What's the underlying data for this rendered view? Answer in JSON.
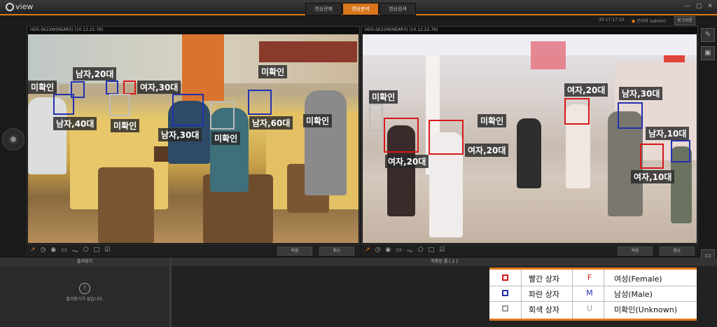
{
  "app": {
    "logo": "view"
  },
  "tabs": [
    {
      "label": "영상관제"
    },
    {
      "label": "영상분석"
    },
    {
      "label": "영상검색"
    }
  ],
  "window_controls": [
    "—",
    "□",
    "✕"
  ],
  "status": {
    "time": "30  17:17:10",
    "user": "관리자 (admin)",
    "logout": "로그아웃"
  },
  "panels": [
    {
      "title": "HDS-SK22W(NEAR3) (10.12.22.76)",
      "btn1": "적용",
      "btn2": "취소"
    },
    {
      "title": "HDS-SK22W(NEAR3) (10.12.22.76)",
      "btn1": "적용",
      "btn2": "취소"
    }
  ],
  "control_icons": [
    "↗",
    "◷",
    "◉",
    "▭",
    "〜",
    "⬠",
    "□",
    "☑"
  ],
  "detections_left": [
    {
      "label": "남자,20대"
    },
    {
      "label": "미확인"
    },
    {
      "label": "여자,30대"
    },
    {
      "label": "미확인"
    },
    {
      "label": "남자,40대"
    },
    {
      "label": "미확인"
    },
    {
      "label": "남자,30대"
    },
    {
      "label": "미확인"
    },
    {
      "label": "남자,60대"
    },
    {
      "label": "미확인"
    }
  ],
  "detections_right": [
    {
      "label": "미확인"
    },
    {
      "label": "여자,20대"
    },
    {
      "label": "남자,30대"
    },
    {
      "label": "미확인"
    },
    {
      "label": "여자,20대"
    },
    {
      "label": "남자,10대"
    },
    {
      "label": "여자,20대"
    },
    {
      "label": "여자,10대"
    }
  ],
  "bottom": {
    "favorites_title": "즐겨찾기",
    "favorites_empty": "즐겨찾기가 없습니다.",
    "applied_title": "적용된 룰 [ 2 ]"
  },
  "legend": [
    {
      "color": "#d8181a",
      "desc": "빨간 상자",
      "code": "F",
      "code_color": "#d8181a",
      "gender": "여성(Female)"
    },
    {
      "color": "#2230b0",
      "desc": "파란 상자",
      "code": "M",
      "code_color": "#2230b0",
      "gender": "남성(Male)"
    },
    {
      "color": "#9a9a9a",
      "desc": "회색 상자",
      "code": "U",
      "code_color": "#9a9a9a",
      "gender": "미확인(Unknown)"
    }
  ]
}
